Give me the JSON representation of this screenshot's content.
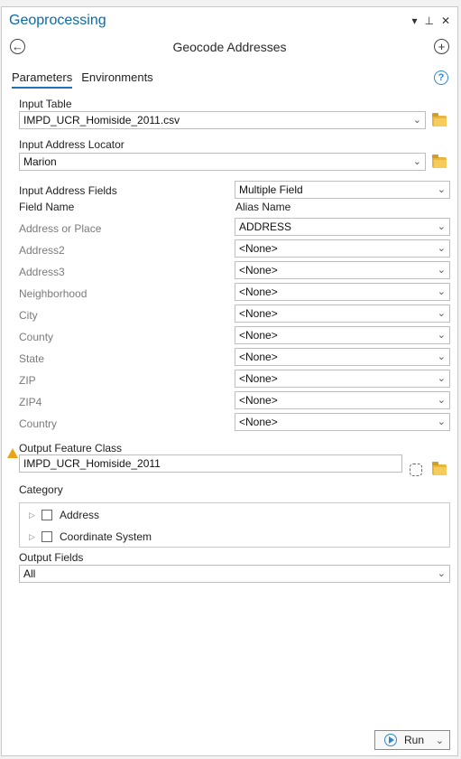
{
  "pane": {
    "title": "Geoprocessing",
    "controls": {
      "menu": "▾",
      "pin": "⊥",
      "close": "✕"
    }
  },
  "tool": {
    "title": "Geocode Addresses",
    "back": "←",
    "add": "+",
    "tabs": {
      "parameters": "Parameters",
      "environments": "Environments"
    },
    "help": "?"
  },
  "params": {
    "input_table_label": "Input Table",
    "input_table_value": "IMPD_UCR_Homiside_2011.csv",
    "locator_label": "Input Address Locator",
    "locator_value": "Marion",
    "fields_label": "Input Address Fields",
    "fields_mode": "Multiple Field",
    "field_name_header": "Field Name",
    "alias_name_header": "Alias Name",
    "field_rows": [
      {
        "name": "Address or Place",
        "value": "ADDRESS"
      },
      {
        "name": "Address2",
        "value": "<None>"
      },
      {
        "name": "Address3",
        "value": "<None>"
      },
      {
        "name": "Neighborhood",
        "value": "<None>"
      },
      {
        "name": "City",
        "value": "<None>"
      },
      {
        "name": "County",
        "value": "<None>"
      },
      {
        "name": "State",
        "value": "<None>"
      },
      {
        "name": "ZIP",
        "value": "<None>"
      },
      {
        "name": "ZIP4",
        "value": "<None>"
      },
      {
        "name": "Country",
        "value": "<None>"
      }
    ],
    "output_label": "Output Feature Class",
    "output_value": "IMPD_UCR_Homiside_2011",
    "category_label": "Category",
    "categories": [
      "Address",
      "Coordinate System"
    ],
    "output_fields_label": "Output Fields",
    "output_fields_value": "All"
  },
  "footer": {
    "run_label": "Run"
  },
  "colors": {
    "accent": "#1f72b8",
    "title": "#0b6aa8",
    "warning": "#e8a317"
  }
}
